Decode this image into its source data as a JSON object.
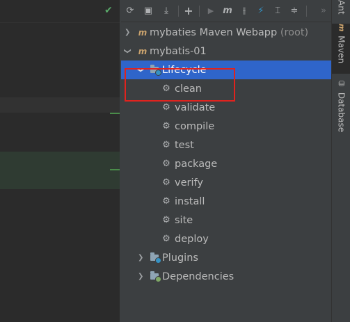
{
  "toolbar": {
    "buttons": [
      {
        "name": "reload-icon",
        "glyph": "⟳"
      },
      {
        "name": "add-folder-icon",
        "glyph": "▣"
      },
      {
        "name": "download-icon",
        "glyph": "⤓"
      },
      {
        "name": "add-icon",
        "glyph": "+"
      },
      {
        "name": "run-icon",
        "glyph": "▶"
      },
      {
        "name": "maven-goal-icon",
        "glyph": "m"
      },
      {
        "name": "skip-tests-icon",
        "glyph": "⫲"
      },
      {
        "name": "offline-icon",
        "glyph": "⚡"
      },
      {
        "name": "show-dependencies-icon",
        "glyph": "⌶"
      },
      {
        "name": "collapse-all-icon",
        "glyph": "≑"
      },
      {
        "name": "more-icon",
        "glyph": "»"
      }
    ]
  },
  "tree": {
    "project1": {
      "name": "mybaties Maven Webapp",
      "suffix": "(root)"
    },
    "project2": {
      "name": "mybatis-01"
    },
    "lifecycle": "Lifecycle",
    "phases": [
      "clean",
      "validate",
      "compile",
      "test",
      "package",
      "verify",
      "install",
      "site",
      "deploy"
    ],
    "plugins": "Plugins",
    "dependencies": "Dependencies"
  },
  "side_tabs": {
    "ant": "Ant",
    "maven": "Maven",
    "database": "Database"
  },
  "colors": {
    "selection": "#2f65ca",
    "highlight_box": "#e0231e",
    "panel_bg": "#3c3f41",
    "editor_bg": "#2b2b2b"
  }
}
